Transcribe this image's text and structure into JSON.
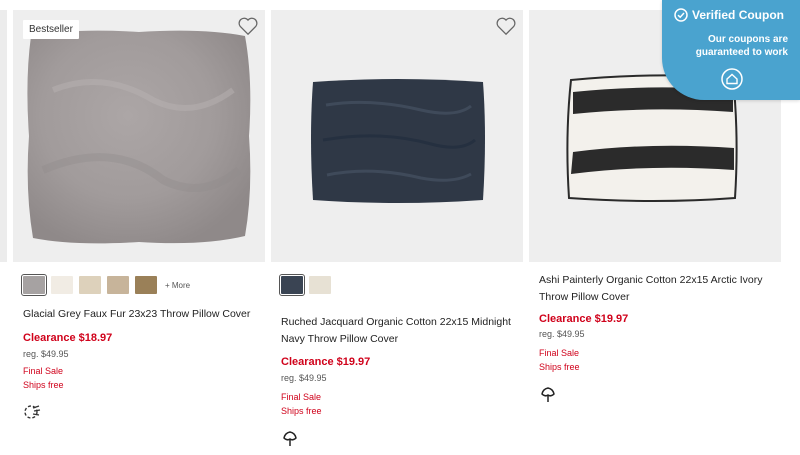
{
  "products": [
    {
      "badge": "Bestseller",
      "name": "Glacial Grey Faux Fur 23x23 Throw Pillow Cover",
      "price_label": "Clearance $18.97",
      "reg_price": "reg. $49.95",
      "final_sale": "Final Sale",
      "shipping": "Ships free",
      "more_label": "+ More",
      "swatches": [
        "#a6a2a2",
        "#f1ece4",
        "#ddd1bb",
        "#c7b49a",
        "#9a8058"
      ],
      "icon": "sustainability-icon"
    },
    {
      "name": "Ruched Jacquard Organic Cotton 22x15 Midnight Navy Throw Pillow Cover",
      "price_label": "Clearance $19.97",
      "reg_price": "reg. $49.95",
      "final_sale": "Final Sale",
      "shipping": "Ships free",
      "swatches": [
        "#3a4453",
        "#e7e1d4"
      ],
      "icon": "organic-cotton-icon"
    },
    {
      "name": "Ashi Painterly Organic Cotton 22x15 Arctic Ivory Throw Pillow Cover",
      "price_label": "Clearance $19.97",
      "reg_price": "reg. $49.95",
      "final_sale": "Final Sale",
      "shipping": "Ships free",
      "icon": "organic-cotton-icon"
    }
  ],
  "coupon": {
    "title": "Verified Coupon",
    "line1": "Our coupons are",
    "line2": "guaranteed to work",
    "color": "#4aa3cf"
  },
  "colors": {
    "sale_red": "#d0021b",
    "image_bg": "#eeeeee"
  }
}
